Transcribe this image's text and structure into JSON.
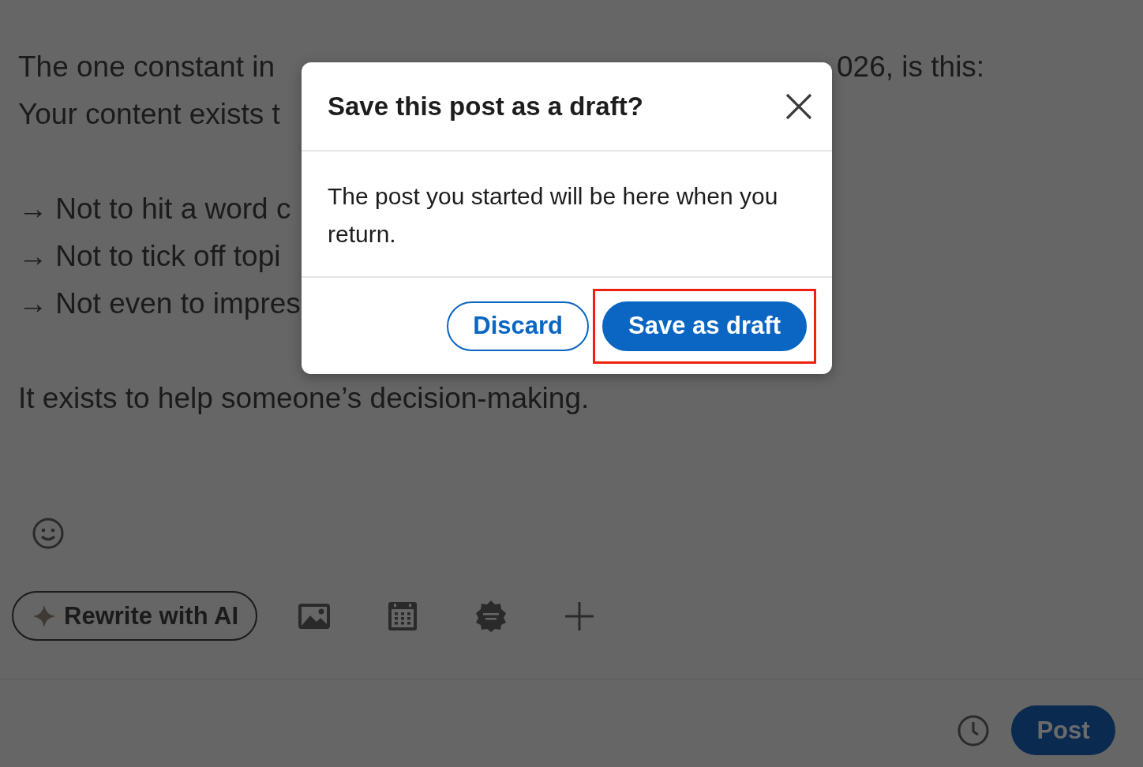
{
  "editor": {
    "paragraphs": [
      [
        {
          "text": "The one constant in",
          "after_dialog": "026, is this:"
        },
        {
          "text": "Your content exists t"
        }
      ],
      [
        {
          "text": "→ Not to hit a word c"
        },
        {
          "text": "→ Not to tick off topi"
        },
        {
          "text": "→ Not even to impres"
        }
      ],
      [
        {
          "text": "It exists to help someone’s decision-making."
        }
      ]
    ]
  },
  "toolbar": {
    "rewrite_button": "Rewrite with AI"
  },
  "footer": {
    "post_button": "Post"
  },
  "dialog": {
    "title": "Save this post as a draft?",
    "body": "The post you started will be here when you return.",
    "buttons": [
      {
        "label": "Discard",
        "kind": "secondary",
        "highlighted": false
      },
      {
        "label": "Save as draft",
        "kind": "primary",
        "highlighted": true
      }
    ]
  }
}
